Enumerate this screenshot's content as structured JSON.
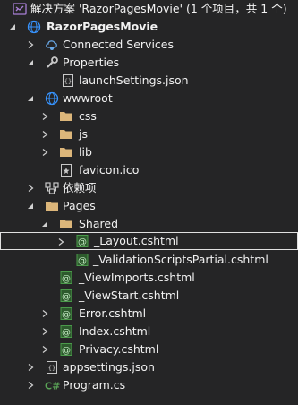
{
  "solution": {
    "label": "解决方案 'RazorPagesMovie' (1 个项目，共 1 个)"
  },
  "project": {
    "label": "RazorPagesMovie",
    "children": {
      "connected_services": "Connected Services",
      "properties": {
        "label": "Properties",
        "launch_settings": "launchSettings.json"
      },
      "wwwroot": {
        "label": "wwwroot",
        "css": "css",
        "js": "js",
        "lib": "lib",
        "favicon": "favicon.ico"
      },
      "dependencies": "依赖项",
      "pages": {
        "label": "Pages",
        "shared": {
          "label": "Shared",
          "layout": "_Layout.cshtml",
          "validation": "_ValidationScriptsPartial.cshtml"
        },
        "view_imports": "_ViewImports.cshtml",
        "view_start": "_ViewStart.cshtml",
        "error": "Error.cshtml",
        "index": "Index.cshtml",
        "privacy": "Privacy.cshtml"
      },
      "appsettings": "appsettings.json",
      "program": "Program.cs"
    }
  },
  "icons": {
    "solution": "visual-studio-solution-icon",
    "project": "web-project-globe-icon",
    "connected_services": "connected-services-icon",
    "properties": "wrench-icon",
    "json": "json-file-icon",
    "folder": "folder-icon",
    "favicon": "favicon-file-icon",
    "dependencies": "dependencies-icon",
    "razor": "razor-file-icon",
    "csharp": "csharp-file-icon"
  },
  "colors": {
    "background": "#252526",
    "text": "#f1f1f1",
    "folder": "#dcb67a",
    "globe": "#3794ff",
    "razor": "#4a9a4a",
    "csharp": "#5aa557",
    "solution": "#a97fd6",
    "selection_border": "#e0e0e0"
  }
}
